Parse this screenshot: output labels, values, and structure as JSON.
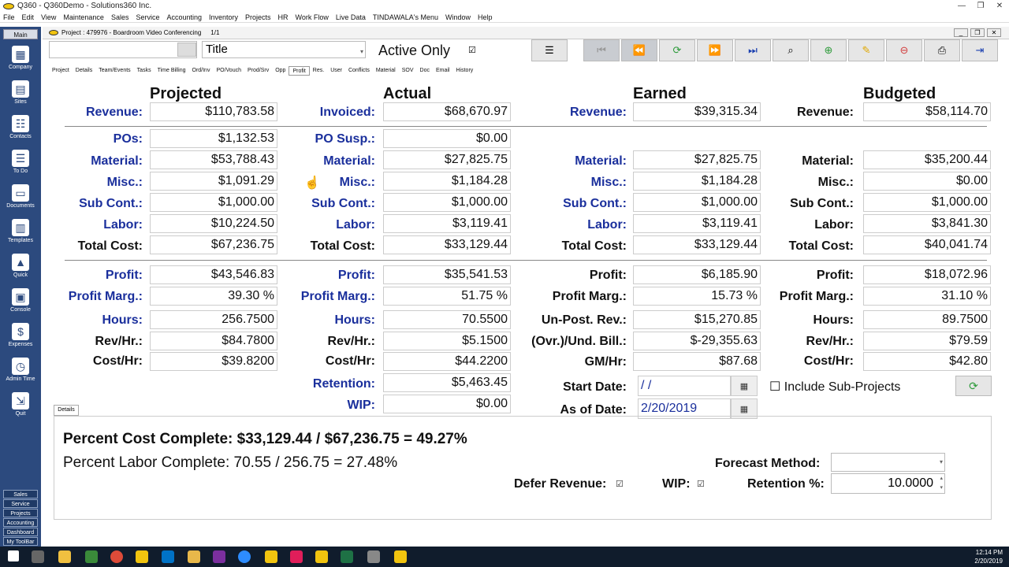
{
  "window": {
    "title": "Q360 - Q360Demo - Solutions360 Inc.",
    "menu": [
      "File",
      "Edit",
      "View",
      "Maintenance",
      "Sales",
      "Service",
      "Accounting",
      "Inventory",
      "Projects",
      "HR",
      "Work Flow",
      "Live Data",
      "TINDAWALA's Menu",
      "Window",
      "Help"
    ]
  },
  "sidebar": {
    "main_label": "Main",
    "items": [
      {
        "label": "Company",
        "icon": "building-icon"
      },
      {
        "label": "Sites",
        "icon": "sites-icon"
      },
      {
        "label": "Contacts",
        "icon": "contact-card-icon"
      },
      {
        "label": "To Do",
        "icon": "list-icon"
      },
      {
        "label": "Documents",
        "icon": "folder-icon"
      },
      {
        "label": "Templates",
        "icon": "template-icon"
      },
      {
        "label": "Quick",
        "icon": "rocket-icon"
      },
      {
        "label": "Console",
        "icon": "monitor-icon"
      },
      {
        "label": "Expenses",
        "icon": "receipt-icon"
      },
      {
        "label": "Admin Time",
        "icon": "admin-time-icon"
      },
      {
        "label": "Quit",
        "icon": "quit-icon"
      }
    ],
    "bottom": [
      "Sales",
      "Service",
      "Projects",
      "Accounting",
      "Dashboard",
      "My ToolBar"
    ]
  },
  "doc": {
    "title": "Project : 479976 - Boardroom Video Conferencing",
    "page": "1/1"
  },
  "toolbar": {
    "title_select": "Title",
    "active_only": "Active Only",
    "active_only_checked": "☑"
  },
  "tabs": [
    "Project",
    "Details",
    "Team/Events",
    "Tasks",
    "Time Billing",
    "Ord/Inv",
    "PO/Vouch",
    "Prod/Srv",
    "Opp",
    "Profit",
    "Res.",
    "User",
    "Conflicts",
    "Material",
    "SOV",
    "Doc",
    "Email",
    "History"
  ],
  "active_tab": "Profit",
  "columns": {
    "projected": "Projected",
    "actual": "Actual",
    "earned": "Earned",
    "budgeted": "Budgeted"
  },
  "projected": {
    "revenue_label": "Revenue:",
    "revenue": "$110,783.58",
    "pos_label": "POs:",
    "pos": "$1,132.53",
    "material_label": "Material:",
    "material": "$53,788.43",
    "misc_label": "Misc.:",
    "misc": "$1,091.29",
    "subcont_label": "Sub Cont.:",
    "subcont": "$1,000.00",
    "labor_label": "Labor:",
    "labor": "$10,224.50",
    "totalcost_label": "Total Cost:",
    "totalcost": "$67,236.75",
    "profit_label": "Profit:",
    "profit": "$43,546.83",
    "profitmarg_label": "Profit Marg.:",
    "profitmarg": "39.30 %",
    "hours_label": "Hours:",
    "hours": "256.7500",
    "revhr_label": "Rev/Hr.:",
    "revhr": "$84.7800",
    "costhr_label": "Cost/Hr:",
    "costhr": "$39.8200"
  },
  "actual": {
    "invoiced_label": "Invoiced:",
    "invoiced": "$68,670.97",
    "posusp_label": "PO Susp.:",
    "posusp": "$0.00",
    "material_label": "Material:",
    "material": "$27,825.75",
    "misc_label": "Misc.:",
    "misc": "$1,184.28",
    "subcont_label": "Sub Cont.:",
    "subcont": "$1,000.00",
    "labor_label": "Labor:",
    "labor": "$3,119.41",
    "totalcost_label": "Total Cost:",
    "totalcost": "$33,129.44",
    "profit_label": "Profit:",
    "profit": "$35,541.53",
    "profitmarg_label": "Profit Marg.:",
    "profitmarg": "51.75 %",
    "hours_label": "Hours:",
    "hours": "70.5500",
    "revhr_label": "Rev/Hr.:",
    "revhr": "$5.1500",
    "costhr_label": "Cost/Hr:",
    "costhr": "$44.2200",
    "retention_label": "Retention:",
    "retention": "$5,463.45",
    "wip_label": "WIP:",
    "wip": "$0.00"
  },
  "earned": {
    "revenue_label": "Revenue:",
    "revenue": "$39,315.34",
    "material_label": "Material:",
    "material": "$27,825.75",
    "misc_label": "Misc.:",
    "misc": "$1,184.28",
    "subcont_label": "Sub Cont.:",
    "subcont": "$1,000.00",
    "labor_label": "Labor:",
    "labor": "$3,119.41",
    "totalcost_label": "Total Cost:",
    "totalcost": "$33,129.44",
    "profit_label": "Profit:",
    "profit": "$6,185.90",
    "profitmarg_label": "Profit Marg.:",
    "profitmarg": "15.73 %",
    "unpost_label": "Un-Post. Rev.:",
    "unpost": "$15,270.85",
    "ovrund_label": "(Ovr.)/Und. Bill.:",
    "ovrund": "$-29,355.63",
    "gmhr_label": "GM/Hr:",
    "gmhr": "$87.68",
    "startdate_label": "Start Date:",
    "startdate": " /  /",
    "asof_label": "As of Date:",
    "asof": "2/20/2019"
  },
  "budgeted": {
    "revenue_label": "Revenue:",
    "revenue": "$58,114.70",
    "material_label": "Material:",
    "material": "$35,200.44",
    "misc_label": "Misc.:",
    "misc": "$0.00",
    "subcont_label": "Sub Cont.:",
    "subcont": "$1,000.00",
    "labor_label": "Labor:",
    "labor": "$3,841.30",
    "totalcost_label": "Total Cost:",
    "totalcost": "$40,041.74",
    "profit_label": "Profit:",
    "profit": "$18,072.96",
    "profitmarg_label": "Profit Marg.:",
    "profitmarg": "31.10 %",
    "hours_label": "Hours:",
    "hours": "89.7500",
    "revhr_label": "Rev/Hr.:",
    "revhr": "$79.59",
    "costhr_label": "Cost/Hr:",
    "costhr": "$42.80",
    "include_sub": "☐ Include Sub-Projects"
  },
  "details": {
    "tab_label": "Details",
    "pct_cost": "Percent Cost Complete: $33,129.44 / $67,236.75 = 49.27%",
    "pct_labor": "Percent Labor Complete: 70.55 / 256.75 = 27.48%",
    "forecast_label": "Forecast Method:",
    "forecast_value": "",
    "defer_label": "Defer Revenue:",
    "defer_checked": "☑",
    "wip_label": "WIP:",
    "wip_checked": "☑",
    "retention_pct_label": "Retention %:",
    "retention_pct": "10.0000"
  },
  "clock": {
    "time": "12:14 PM",
    "date": "2/20/2019"
  }
}
